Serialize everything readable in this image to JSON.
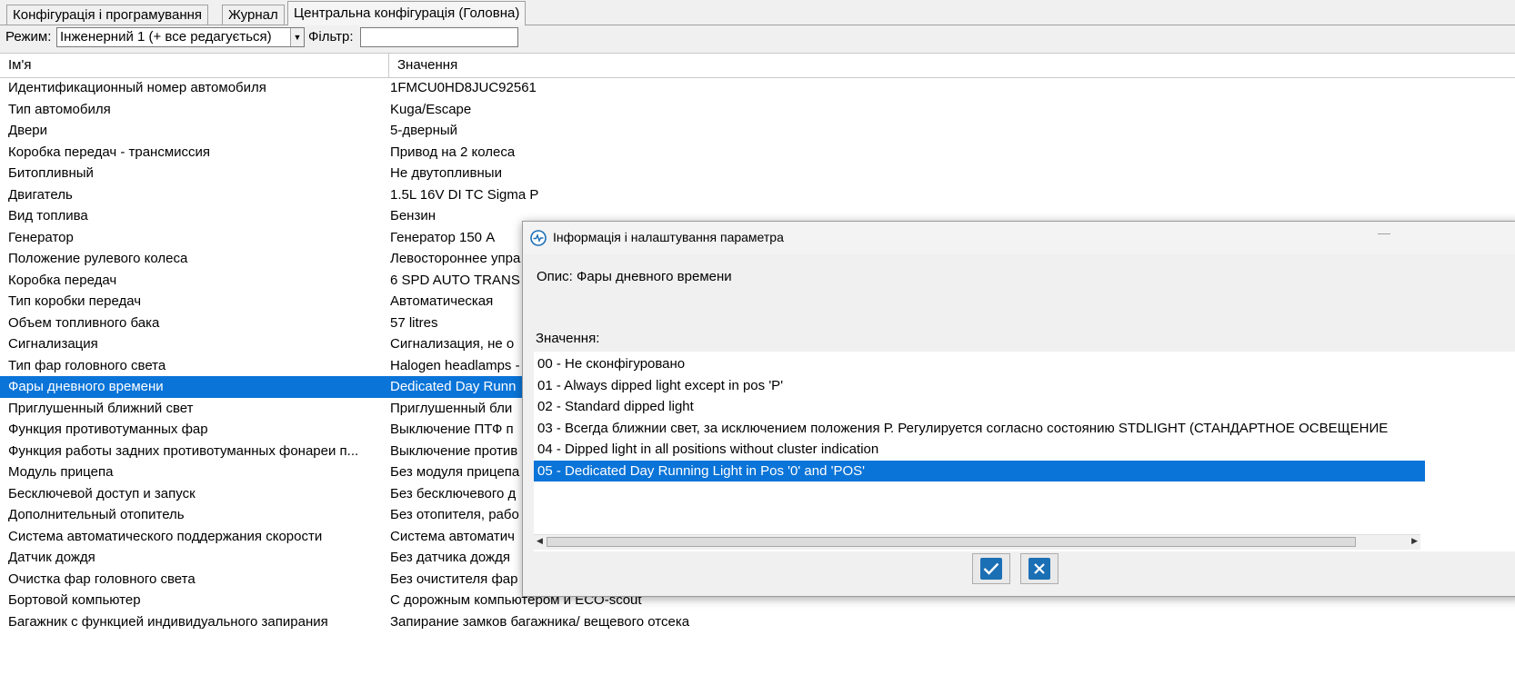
{
  "tabs": [
    {
      "label": "Конфігурація і програмування",
      "active": false
    },
    {
      "label": "Журнал",
      "active": false
    },
    {
      "label": "Центральна конфігурація (Головна)",
      "active": true
    }
  ],
  "modebar": {
    "mode_label": "Режим:",
    "mode_value": "Інженерний 1 (+ все редагується)",
    "filter_label": "Фільтр:",
    "filter_value": ""
  },
  "grid": {
    "columns": [
      "Ім'я",
      "Значення"
    ],
    "selected_index": 14,
    "rows": [
      [
        "Идентификационный номер автомобиля",
        "1FMCU0HD8JUC92561"
      ],
      [
        "Тип автомобиля",
        "Kuga/Escape"
      ],
      [
        "Двери",
        "5-дверный"
      ],
      [
        "Коробка передач - трансмиссия",
        "Привод на 2 колеса"
      ],
      [
        "Битопливный",
        "Не двутопливныи"
      ],
      [
        "Двигатель",
        "1.5L 16V DI TC Sigma P"
      ],
      [
        "Вид топлива",
        "Бензин"
      ],
      [
        "Генератор",
        "Генератор 150 A"
      ],
      [
        "Положение рулевого колеса",
        "Левостороннее упра"
      ],
      [
        "Коробка передач",
        "6 SPD AUTO TRANS"
      ],
      [
        "Тип коробки передач",
        "Автоматическая"
      ],
      [
        "Объем топливного бака",
        "57 litres"
      ],
      [
        "Сигнализация",
        "Сигнализация, не о"
      ],
      [
        "Тип фар головного света",
        "Halogen headlamps -"
      ],
      [
        "Фары дневного времени",
        "Dedicated Day Runn"
      ],
      [
        "Приглушенный ближний свет",
        "Приглушенный бли"
      ],
      [
        "Функция противотуманных фар",
        "Выключение ПТФ п"
      ],
      [
        "Функция работы задних противотуманных фонареи п...",
        "Выключение против"
      ],
      [
        "Модуль прицепа",
        "Без модуля прицепа"
      ],
      [
        "Бесключевой доступ и запуск",
        "Без бесключевого д"
      ],
      [
        "Дополнительный отопитель",
        "Без отопителя, рабо"
      ],
      [
        "Система автоматического поддержания скорости",
        "Система автоматич"
      ],
      [
        "Датчик дождя",
        "Без датчика дождя"
      ],
      [
        "Очистка фар головного света",
        "Без очистителя фар"
      ],
      [
        "Бортовой компьютер",
        "С дорожным компьютером и ECO-scout"
      ],
      [
        "Багажник с функцией индивидуального запирания",
        "Запирание замков багажника/ вещевого отсека"
      ]
    ]
  },
  "dialog": {
    "title": "Інформація і налаштування параметра",
    "title_icon": "settings-app-icon",
    "minimize_glyph": "—",
    "description": "Опис: Фары дневного времени",
    "values_label": "Значення:",
    "selected_index": 5,
    "options": [
      "00 - Не сконфігуровано",
      "01 - Always dipped light except in pos 'P'",
      "02 - Standard dipped light",
      "03 - Всегда ближнии свет, за исключением положения Р. Регулируется согласно состоянию STDLIGHT (СТАНДАРТНОЕ ОСВЕЩЕНИЕ",
      "04 - Dipped light in all positions without cluster indication",
      "05 - Dedicated Day Running Light in Pos '0' and 'POS'"
    ],
    "ok_icon": "checkmark-icon",
    "cancel_icon": "close-icon"
  },
  "colors": {
    "selection": "#0a74d8",
    "button_icon": "#1b6fb5"
  }
}
